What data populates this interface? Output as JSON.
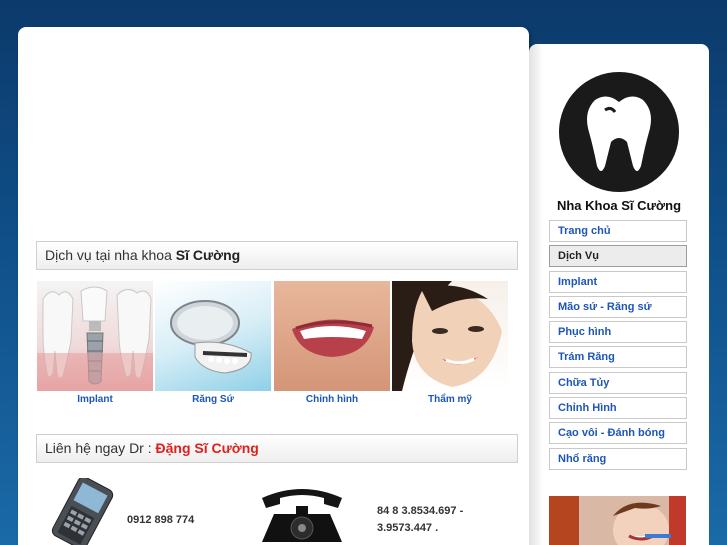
{
  "services": {
    "heading_prefix": "Dịch vụ tại nha khoa ",
    "heading_bold": "Sĩ Cường",
    "items": [
      {
        "label": "Implant",
        "icon": "dental-implant-image"
      },
      {
        "label": "Răng Sứ",
        "icon": "porcelain-teeth-image"
      },
      {
        "label": "Chỉnh hình",
        "icon": "smile-image"
      },
      {
        "label": "Thẩm mỹ",
        "icon": "smiling-woman-image"
      }
    ]
  },
  "contact": {
    "heading_prefix": "Liên hệ ngay Dr : ",
    "heading_name": "Đặng Sĩ Cường",
    "mobile": "0912 898 774",
    "phone_line1": "84 8 3.8534.697 -",
    "phone_line2": "3.9573.447 ."
  },
  "sidebar": {
    "brand": "Nha Khoa Sĩ Cường",
    "menu": [
      {
        "label": "Trang chủ"
      },
      {
        "label": "Dịch Vụ"
      },
      {
        "label": "Implant"
      },
      {
        "label": "Mão sứ - Răng sứ"
      },
      {
        "label": "Phục hình"
      },
      {
        "label": "Trám Răng"
      },
      {
        "label": "Chữa Tủy"
      },
      {
        "label": "Chỉnh Hình"
      },
      {
        "label": "Cạo vôi - Đánh bóng"
      },
      {
        "label": "Nhổ răng"
      }
    ],
    "active_index": 1
  },
  "colors": {
    "link": "#1d56b6",
    "accent_red": "#e0201b",
    "background": "#0f4d86"
  }
}
